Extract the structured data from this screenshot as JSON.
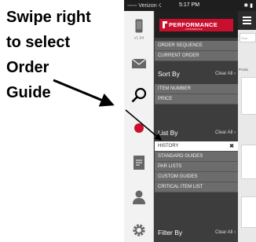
{
  "annotation": {
    "lines": [
      "Swipe right",
      "to select",
      "Order",
      "Guide"
    ]
  },
  "status_bar": {
    "carrier": "◦◦◦◦◦ Verizon ☇",
    "time": "5:17 PM",
    "battery": "✱ ▮"
  },
  "rail": {
    "version": "v1.94"
  },
  "brand": {
    "logo_text": "PERFORMANCE",
    "logo_subtext": "FOODSERVICE"
  },
  "menu": {
    "top_items": [
      "ORDER SEQUENCE",
      "CURRENT ORDER"
    ],
    "sort_by": {
      "label": "Sort By",
      "clear": "Clear All ›",
      "items": [
        "ITEM NUMBER",
        "PRICE"
      ]
    },
    "list_by": {
      "label": "List By",
      "clear": "Clear All ›",
      "selected": "HISTORY",
      "selected_close": "✖",
      "items": [
        "STANDARD GUIDES",
        "PAR LISTS",
        "CUSTOM GUIDES",
        "CRITICAL ITEM LIST"
      ]
    },
    "filter_by": {
      "label": "Filter By",
      "clear": "Clear All ›"
    }
  },
  "content": {
    "search_placeholder": "Sear",
    "products_label": "Produ"
  },
  "colors": {
    "brand_red": "#c8102e",
    "menu_dark": "#3d3d3d",
    "menu_item": "#6c6c6c"
  }
}
